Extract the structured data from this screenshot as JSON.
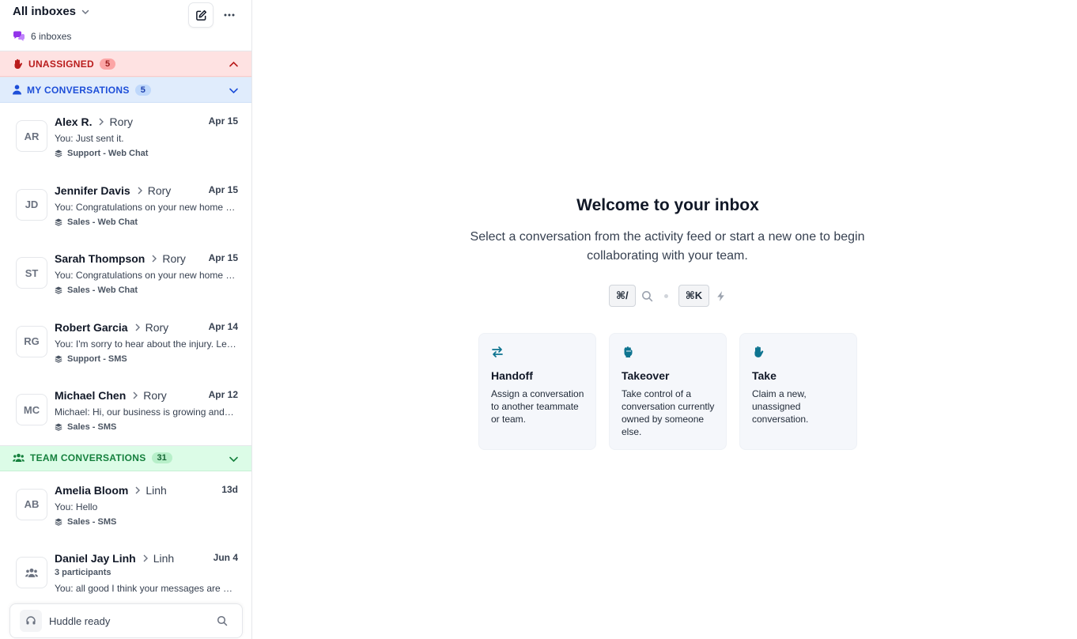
{
  "sidebar": {
    "title": "All inboxes",
    "inbox_count": "6 inboxes",
    "sections": {
      "unassigned": {
        "label": "UNASSIGNED",
        "count": "5"
      },
      "mine": {
        "label": "MY CONVERSATIONS",
        "count": "5"
      },
      "team": {
        "label": "TEAM CONVERSATIONS",
        "count": "31"
      }
    },
    "my_conversations": [
      {
        "initials": "AR",
        "name": "Alex R.",
        "agent": "Rory",
        "date": "Apr 15",
        "preview": "You: Just sent it.",
        "inbox": "Support - Web Chat"
      },
      {
        "initials": "JD",
        "name": "Jennifer Davis",
        "agent": "Rory",
        "date": "Apr 15",
        "preview": "You: Congratulations on your new home purchase!",
        "inbox": "Sales - Web Chat"
      },
      {
        "initials": "ST",
        "name": "Sarah Thompson",
        "agent": "Rory",
        "date": "Apr 15",
        "preview": "You: Congratulations on your new home purchase!",
        "inbox": "Sales - Web Chat"
      },
      {
        "initials": "RG",
        "name": "Robert Garcia",
        "agent": "Rory",
        "date": "Apr 14",
        "preview": "You: I'm sorry to hear about the injury. Let me help.",
        "inbox": "Support - SMS"
      },
      {
        "initials": "MC",
        "name": "Michael Chen",
        "agent": "Rory",
        "date": "Apr 12",
        "preview": "Michael: Hi, our business is growing and we need more coverage",
        "inbox": "Sales - SMS"
      }
    ],
    "team_conversations": [
      {
        "initials": "AB",
        "name": "Amelia Bloom",
        "agent": "Linh",
        "date": "13d",
        "preview": "You: Hello",
        "inbox": "Sales - SMS"
      },
      {
        "name": "Daniel Jay Linh",
        "agent": "Linh",
        "date": "Jun 4",
        "participants": "3 participants",
        "preview": "You: all good I think your messages are coming through"
      }
    ],
    "huddle": {
      "label": "Huddle ready"
    }
  },
  "main": {
    "title": "Welcome to your inbox",
    "subtitle": "Select a conversation from the activity feed or start a new one to begin collaborating with your team.",
    "shortcuts": {
      "search_key": "⌘/",
      "command_key": "⌘K"
    },
    "cards": [
      {
        "title": "Handoff",
        "desc": "Assign a conversation to another teammate or team."
      },
      {
        "title": "Takeover",
        "desc": "Take control of a conversation currently owned by someone else."
      },
      {
        "title": "Take",
        "desc": "Claim a new, unassigned conversation."
      }
    ]
  },
  "colors": {
    "accent_blue": "#1d4ed8",
    "unassigned_red": "#b91c1c",
    "team_green": "#15803d",
    "card_icon_teal": "#0e7490"
  }
}
